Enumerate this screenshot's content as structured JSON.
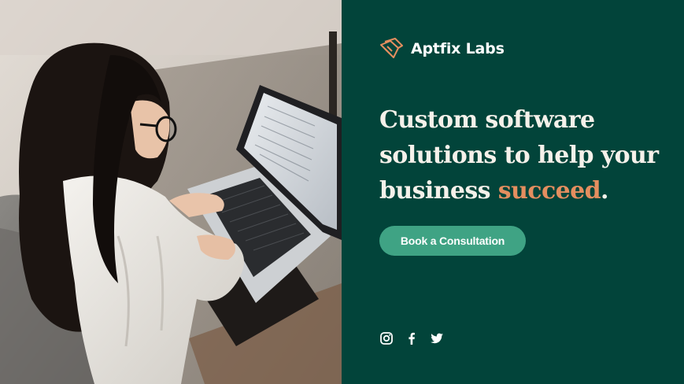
{
  "hero_image": {
    "icon": "woman-working-on-laptop-photo"
  },
  "brand": {
    "logo_icon": "stacked-chevrons-logo-icon",
    "name": "Aptfix Labs",
    "accent_color": "#e48e5f"
  },
  "headline": {
    "text_before": "Custom software solutions to help your business ",
    "accent_word": "succeed",
    "text_after": "."
  },
  "cta": {
    "label": "Book a Consultation",
    "color": "#3fa384"
  },
  "social": [
    {
      "icon": "instagram-icon"
    },
    {
      "icon": "facebook-icon"
    },
    {
      "icon": "twitter-icon"
    }
  ],
  "colors": {
    "panel_background": "#02443a",
    "headline_text": "#f5f1ea"
  }
}
